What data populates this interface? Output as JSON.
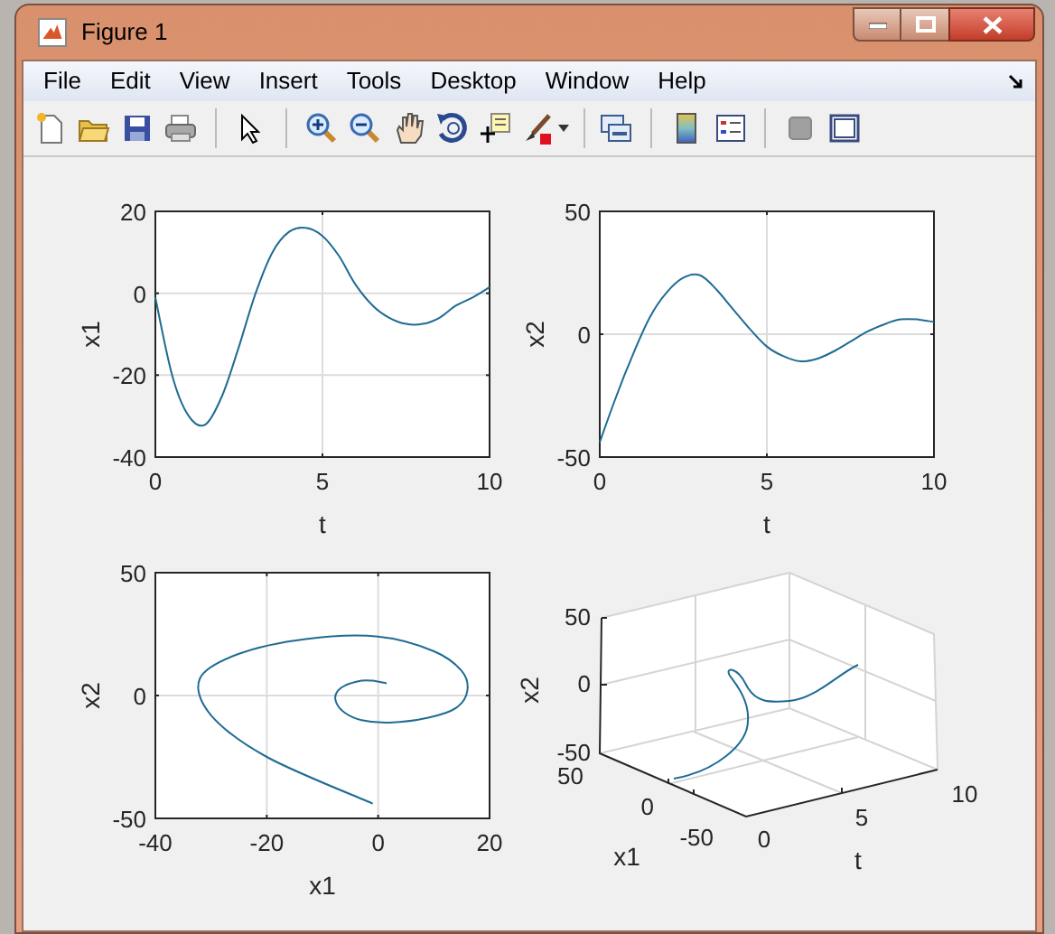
{
  "window": {
    "title": "Figure 1"
  },
  "menu": [
    "File",
    "Edit",
    "View",
    "Insert",
    "Tools",
    "Desktop",
    "Window",
    "Help"
  ],
  "subplots": [
    {
      "kind": "planar",
      "chart_data": {
        "type": "line",
        "grid": true,
        "xlabel": "t",
        "ylabel": "x1",
        "x": [
          0,
          0.5,
          1,
          1.5,
          2,
          2.5,
          3,
          3.5,
          4,
          4.5,
          5,
          5.5,
          6,
          6.5,
          7,
          7.5,
          8,
          8.5,
          9,
          9.5,
          10
        ],
        "series": [
          {
            "color": "#1f6b93",
            "values": [
              -1,
              -20,
              -30,
              -32,
              -25,
              -13,
              0,
              10,
              15,
              16,
              14,
              9,
              2,
              -3,
              -6,
              -7.5,
              -7.5,
              -6,
              -3,
              -1,
              1.5
            ]
          }
        ],
        "xlim": [
          0,
          10
        ],
        "ylim": [
          -40,
          20
        ],
        "xticks": [
          0,
          5,
          10
        ],
        "yticks": [
          -40,
          -20,
          0,
          20
        ]
      }
    },
    {
      "kind": "planar",
      "chart_data": {
        "type": "line",
        "grid": true,
        "xlabel": "t",
        "ylabel": "x2",
        "x": [
          0,
          0.5,
          1,
          1.5,
          2,
          2.5,
          3,
          3.5,
          4,
          4.5,
          5,
          5.5,
          6,
          6.5,
          7,
          7.5,
          8,
          8.5,
          9,
          9.5,
          10
        ],
        "series": [
          {
            "color": "#1f6b93",
            "values": [
              -44,
              -25,
              -8,
              7,
              17,
              23,
              24,
              18,
              10,
              2,
              -5,
              -9,
              -11,
              -10,
              -7,
              -3,
              1,
              4,
              6,
              6,
              5
            ]
          }
        ],
        "xlim": [
          0,
          10
        ],
        "ylim": [
          -50,
          50
        ],
        "xticks": [
          0,
          5,
          10
        ],
        "yticks": [
          -50,
          0,
          50
        ]
      }
    },
    {
      "kind": "planar",
      "chart_data": {
        "type": "line",
        "grid": true,
        "xlabel": "x1",
        "ylabel": "x2",
        "x": [
          -1,
          -20,
          -30,
          -32,
          -25,
          -13,
          0,
          10,
          15,
          16,
          14,
          9,
          2,
          -3,
          -6,
          -7.5,
          -7.5,
          -6,
          -3,
          -1,
          1.5
        ],
        "series": [
          {
            "color": "#1f6b93",
            "values": [
              -44,
              -25,
              -8,
              7,
              17,
              23,
              24,
              18,
              10,
              2,
              -5,
              -9,
              -11,
              -10,
              -7,
              -3,
              1,
              4,
              6,
              6,
              5
            ]
          }
        ],
        "xlim": [
          -40,
          20
        ],
        "ylim": [
          -50,
          50
        ],
        "xticks": [
          -40,
          -20,
          0,
          20
        ],
        "yticks": [
          -50,
          0,
          50
        ]
      }
    },
    {
      "kind": "spatial",
      "zlabel": "x2",
      "ylabel": "x1",
      "xlabel": "t",
      "zticks": [
        "50",
        "0",
        "-50"
      ],
      "yticks": [
        "50",
        "0",
        "-50"
      ],
      "xticks": [
        "0",
        "5",
        "10"
      ]
    }
  ]
}
